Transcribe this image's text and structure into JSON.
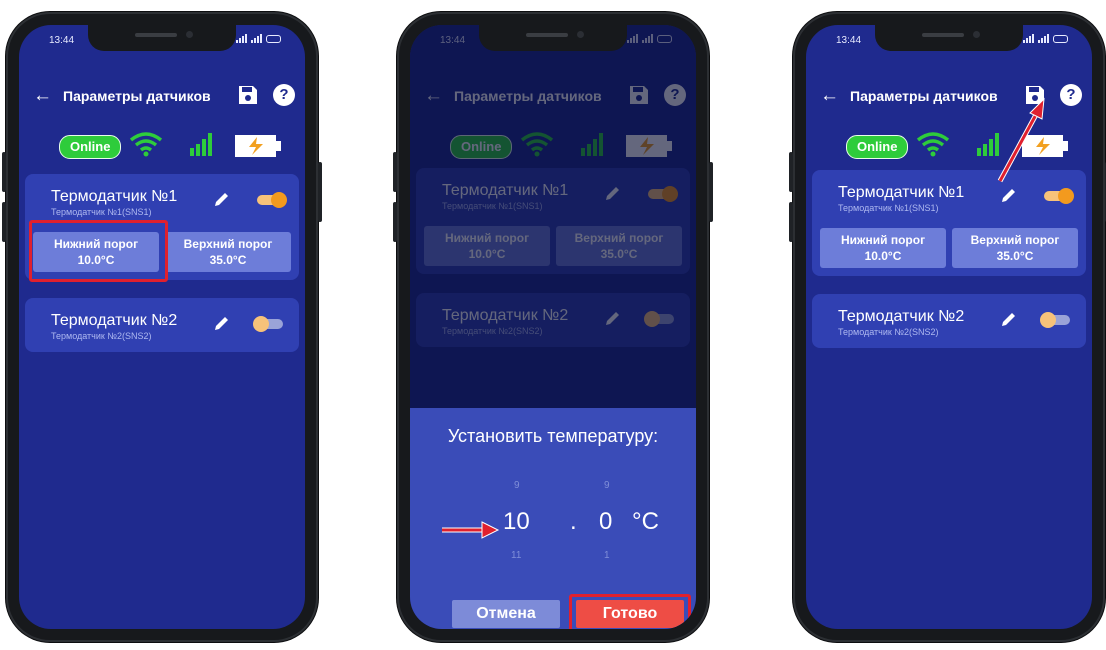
{
  "status": {
    "time": "13:44"
  },
  "appbar": {
    "back_icon": "←",
    "title": "Параметры датчиков",
    "help_icon": "?"
  },
  "indicators": {
    "online": "Online"
  },
  "sensors": [
    {
      "name": "Термодатчик №1",
      "subtitle": "Термодатчик №1(SNS1)",
      "enabled": true
    },
    {
      "name": "Термодатчик №2",
      "subtitle": "Термодатчик №2(SNS2)",
      "enabled": false
    }
  ],
  "thresholds": {
    "low_label": "Нижний порог",
    "low_value": "10.0°C",
    "high_label": "Верхний порог",
    "high_value": "35.0°C"
  },
  "dialog": {
    "title": "Установить температуру:",
    "integer_prev": "9",
    "integer_value": "10",
    "integer_next": "11",
    "separator": ".",
    "fraction_prev": "9",
    "fraction_value": "0",
    "fraction_next": "1",
    "unit": "°C",
    "cancel": "Отмена",
    "done": "Готово"
  },
  "colors": {
    "screen_bg": "#1f2a8e",
    "card_bg": "#3040b2",
    "threshold_bg": "#6d7dd9",
    "online_green": "#2ecc3b",
    "highlight_red": "#e0202e",
    "toggle_on": "#f39a1e"
  }
}
